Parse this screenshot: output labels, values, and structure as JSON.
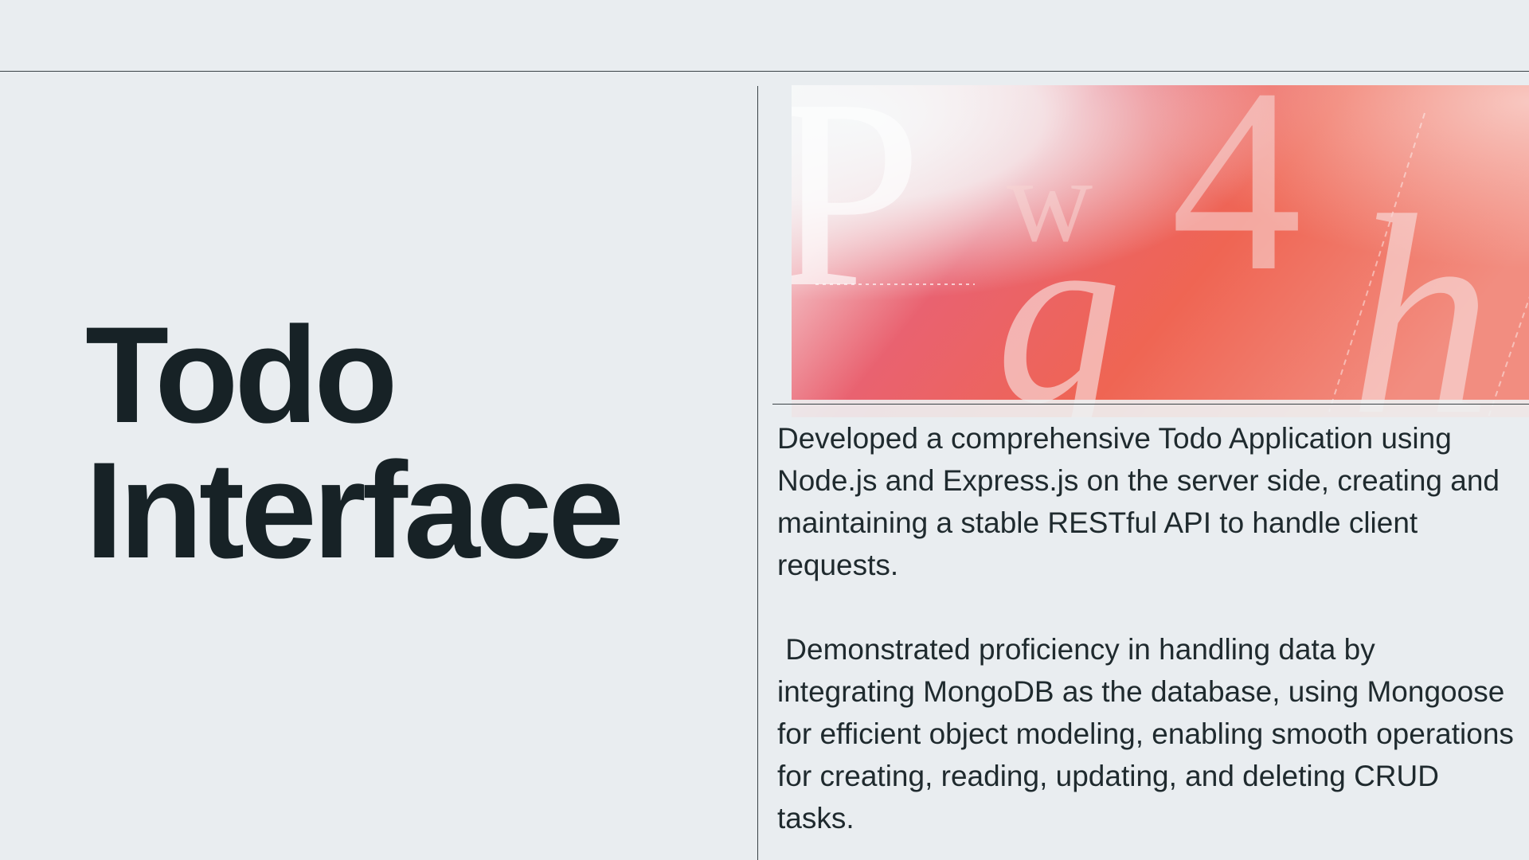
{
  "slide": {
    "title_line_1": "Todo",
    "title_line_2": "Interface",
    "paragraphs": [
      "Developed a comprehensive Todo Application using Node.js and Express.js on the server side, creating and maintaining a stable RESTful API to handle client requests.",
      " Demonstrated proficiency in handling data by integrating MongoDB as the database, using Mongoose for efficient object modeling, enabling smooth operations for creating, reading, updating, and deleting CRUD tasks."
    ]
  },
  "hero_image": {
    "description_icon": "typography-gradient-image",
    "glyphs": [
      "P",
      "w",
      "4",
      "g",
      "h"
    ],
    "colors": {
      "light": "#f3f5f6",
      "pink": "#ea5d67",
      "coral": "#f06f4f",
      "glyph": "#f8d6d4"
    }
  }
}
